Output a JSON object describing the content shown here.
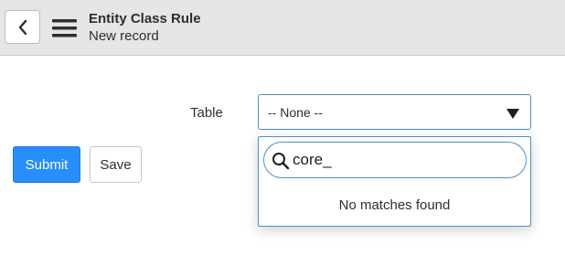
{
  "header": {
    "title": "Entity Class Rule",
    "subtitle": "New record",
    "back_icon": "chevron-left-icon",
    "menu_icon": "hamburger-menu-icon"
  },
  "form": {
    "table_label": "Table",
    "table_select_value": "-- None --",
    "select_arrow_icon": "caret-down-icon"
  },
  "actions": {
    "submit_label": "Submit",
    "save_label": "Save"
  },
  "dropdown": {
    "search_value": "core_",
    "search_icon": "search-icon",
    "empty_message": "No matches found"
  },
  "colors": {
    "header_bg": "#e4e6e7",
    "primary": "#278efc",
    "focus_border": "#4a8ecb"
  }
}
